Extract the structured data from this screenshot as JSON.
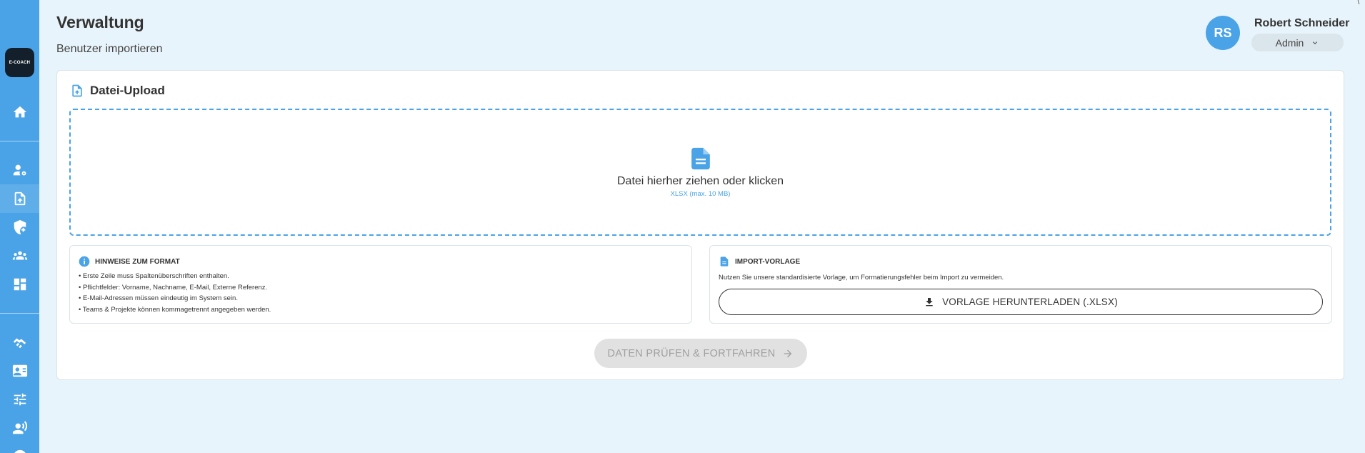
{
  "sidebar": {
    "logo_text": "E-COACH",
    "items": [
      {
        "name": "home-icon"
      },
      {
        "name": "user-settings-icon"
      },
      {
        "name": "file-upload-icon"
      },
      {
        "name": "shield-add-icon"
      },
      {
        "name": "groups-icon"
      },
      {
        "name": "dashboard-icon"
      },
      {
        "name": "handshake-icon"
      },
      {
        "name": "contact-card-icon"
      },
      {
        "name": "tune-icon"
      },
      {
        "name": "speaker-person-icon"
      }
    ],
    "active_item": "file-upload-icon",
    "accent_color": "#4aa3e6"
  },
  "header": {
    "title": "Verwaltung",
    "subtitle": "Benutzer importieren"
  },
  "user": {
    "initials": "RS",
    "name": "Robert Schneider",
    "role": "Admin"
  },
  "upload_card": {
    "title": "Datei-Upload",
    "dropzone_text": "Datei hierher ziehen oder klicken",
    "dropzone_hint": "XLSX (max. 10 MB)"
  },
  "format_hints": {
    "title": "HINWEISE ZUM FORMAT",
    "items": [
      "• Erste Zeile muss Spaltenüberschriften enthalten.",
      "• Pflichtfelder: Vorname, Nachname, E-Mail, Externe Referenz.",
      "• E-Mail-Adressen müssen eindeutig im System sein.",
      "• Teams & Projekte können kommagetrennt angegeben werden."
    ]
  },
  "import_template": {
    "title": "IMPORT-VORLAGE",
    "description": "Nutzen Sie unsere standardisierte Vorlage, um Formatierungsfehler beim Import zu vermeiden.",
    "download_label": "VORLAGE HERUNTERLADEN (.XLSX)"
  },
  "actions": {
    "submit_label": "DATEN PRÜFEN & FORTFAHREN",
    "submit_disabled": true
  },
  "window": {
    "corner_glyph": "\\"
  }
}
